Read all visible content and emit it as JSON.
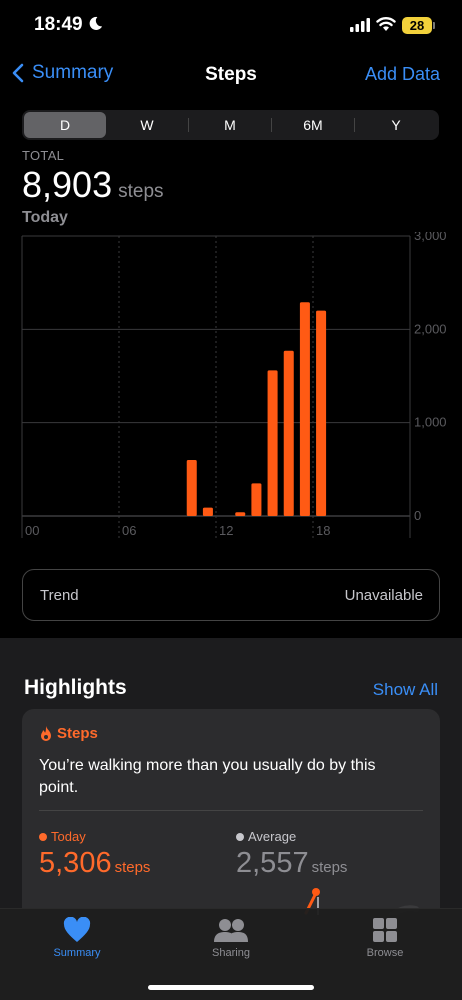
{
  "status_bar": {
    "time": "18:49",
    "battery": "28"
  },
  "nav": {
    "back_label": "Summary",
    "title": "Steps",
    "add_label": "Add Data"
  },
  "segments": [
    "D",
    "W",
    "M",
    "6M",
    "Y"
  ],
  "selected_segment": "D",
  "summary": {
    "total_label": "TOTAL",
    "total_value": "8,903",
    "total_unit": "steps",
    "period": "Today"
  },
  "chart_data": {
    "type": "bar",
    "x_axis": {
      "label": "hour of day",
      "ticks": [
        "00",
        "06",
        "12",
        "18"
      ],
      "range": [
        0,
        24
      ]
    },
    "y_axis": {
      "ticks": [
        "3,000",
        "2,000",
        "1,000",
        "0"
      ],
      "range": [
        0,
        3000
      ],
      "position": "right"
    },
    "grid": true,
    "color": "#ff5a14",
    "bars": [
      {
        "hour": 10,
        "value": 600
      },
      {
        "hour": 11,
        "value": 90
      },
      {
        "hour": 13,
        "value": 40
      },
      {
        "hour": 14,
        "value": 350
      },
      {
        "hour": 15,
        "value": 1560
      },
      {
        "hour": 16,
        "value": 1770
      },
      {
        "hour": 17,
        "value": 2290
      },
      {
        "hour": 18,
        "value": 2200
      }
    ]
  },
  "trend": {
    "label": "Trend",
    "value": "Unavailable"
  },
  "highlights": {
    "title": "Highlights",
    "show_all": "Show All",
    "card": {
      "category": "Steps",
      "message": "You’re walking more than you usually do by this point.",
      "today_label": "Today",
      "today_value": "5,306",
      "today_unit": "steps",
      "average_label": "Average",
      "average_value": "2,557",
      "average_unit": "steps"
    }
  },
  "tabs": [
    {
      "label": "Summary",
      "icon": "heart-icon",
      "active": true
    },
    {
      "label": "Sharing",
      "icon": "people-icon",
      "active": false
    },
    {
      "label": "Browse",
      "icon": "grid-icon",
      "active": false
    }
  ],
  "colors": {
    "accent_blue": "#3a8ef6",
    "activity_orange": "#ff5a14",
    "battery": "#f2d13b"
  }
}
